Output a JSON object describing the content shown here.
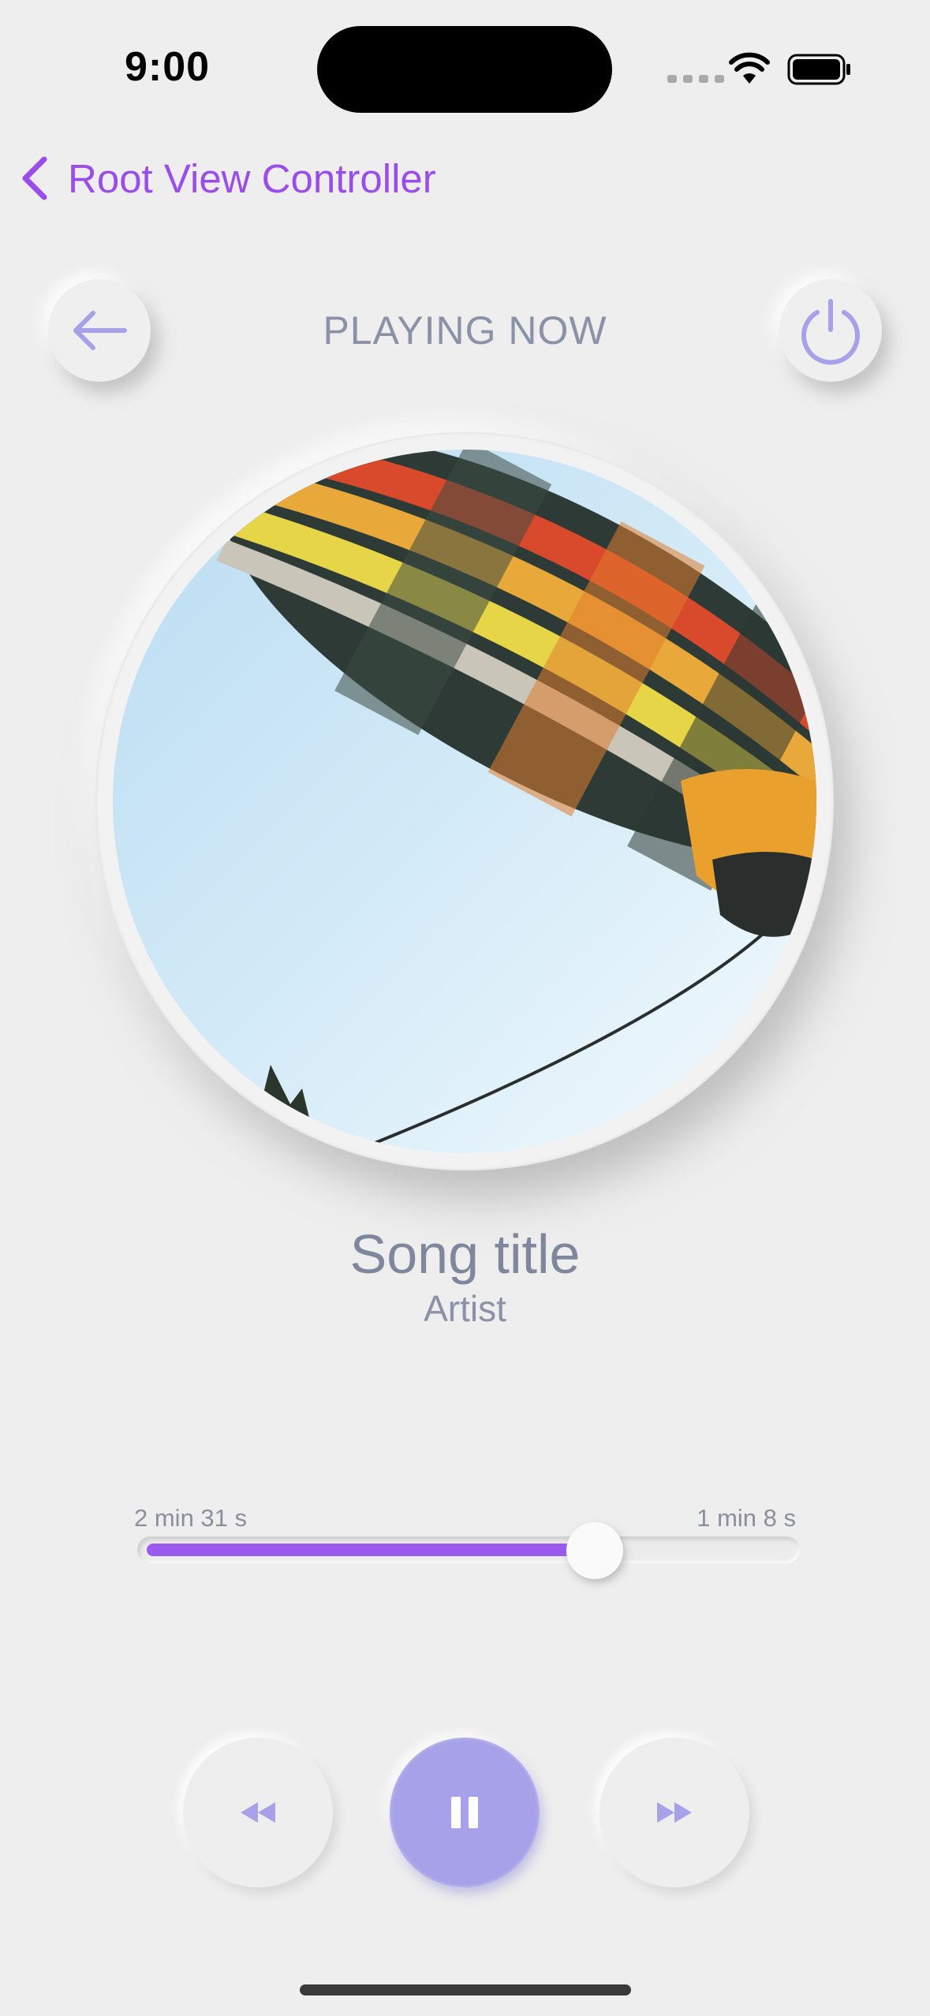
{
  "status_bar": {
    "time": "9:00"
  },
  "nav": {
    "back_label": "Root View Controller"
  },
  "header": {
    "title": "PLAYING NOW"
  },
  "song": {
    "title": "Song title",
    "artist": "Artist"
  },
  "progress": {
    "elapsed": "2 min 31 s",
    "remaining": "1 min 8 s",
    "fraction": 0.69
  },
  "colors": {
    "accent": "#9b4dec",
    "progress_fill": "#9b59f0",
    "play_button": "#a6a1e8",
    "icon_tint": "#a6a1e8",
    "text_secondary": "#8a92a8"
  },
  "icons": {
    "back": "arrow-left-icon",
    "power": "power-icon",
    "previous": "rewind-icon",
    "pause": "pause-icon",
    "next": "fast-forward-icon"
  }
}
